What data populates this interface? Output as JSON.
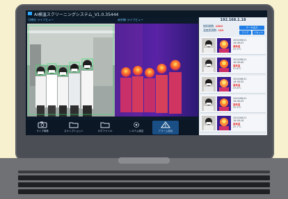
{
  "window": {
    "title": "AI検温スクリーニングシステム_V1.0.35444"
  },
  "main": {
    "camera_label": "可視光 ライブビュー",
    "thermal_label": "赤外線 ライブビュー"
  },
  "toolbar": {
    "buttons": [
      {
        "label": "ライブ映像",
        "icon": "camera-icon"
      },
      {
        "label": "スナップショット",
        "icon": "folder-icon"
      },
      {
        "label": "ログファイル",
        "icon": "folder-icon"
      },
      {
        "label": "システム設定",
        "icon": "gear-icon"
      },
      {
        "label": "アラーム設定",
        "icon": "warning-icon"
      }
    ]
  },
  "sidebar": {
    "ip": "192.168.1.18",
    "stats": {
      "total_label": "検知総数:",
      "total_value": "2689",
      "alarm_label": "温度超過数:",
      "alarm_value": "189"
    },
    "buttons": [
      "データ出力",
      "クリア",
      "リセット"
    ],
    "records": [
      {
        "date": "2020/06/11",
        "time": "16:06:47",
        "temp": "高体温",
        "status": "37.5°C"
      },
      {
        "date": "2020/06/11",
        "time": "16:06:40",
        "temp": "高体温",
        "status": "37.6°C"
      },
      {
        "date": "2020/06/11",
        "time": "16:06:32",
        "temp": "高体温",
        "status": "37.8°C"
      },
      {
        "date": "2020/06/11",
        "time": "16:06:25",
        "temp": "高体温",
        "status": "37.5°C"
      },
      {
        "date": "2020/06/11",
        "time": "16:06:18",
        "temp": "高体温",
        "status": "37.7°C"
      }
    ]
  },
  "colors": {
    "accent": "#1e7de6",
    "alarm": "#e5342f",
    "detect_box": "#37e06a"
  }
}
